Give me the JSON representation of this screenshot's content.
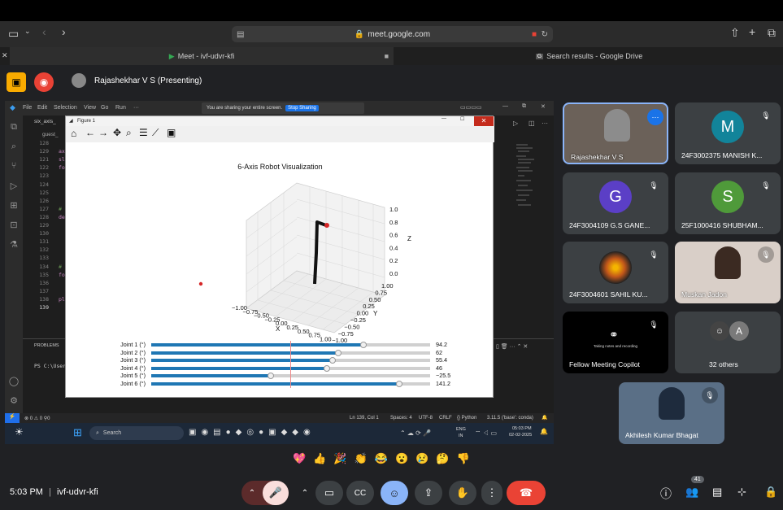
{
  "browser": {
    "url": "meet.google.com",
    "tabs": [
      {
        "label": "Meet - ivf-udvr-kfi"
      },
      {
        "label": "Search results - Google Drive"
      }
    ]
  },
  "meet": {
    "presenter_label": "Rajashekhar V S (Presenting)"
  },
  "screen_share": {
    "share_notice": "You are sharing your entire screen.",
    "stop_sharing": "Stop Sharing",
    "explorer_tab": "six_axis_",
    "breadcrumb": "guest_",
    "line_numbers": [
      "128",
      "129",
      "121",
      "122",
      "123",
      "124",
      "125",
      "126",
      "127",
      "128",
      "129",
      "130",
      "131",
      "132",
      "133",
      "134",
      "135",
      "136",
      "137",
      "138",
      "139"
    ],
    "code_snippets": [
      {
        "line": "129",
        "text": "ax_"
      },
      {
        "line": "121",
        "text": "sli"
      },
      {
        "line": "122",
        "text": "for"
      },
      {
        "line": "127",
        "text": "# U"
      },
      {
        "line": "128",
        "text": "def"
      },
      {
        "line": "134",
        "text": "# A"
      },
      {
        "line": "135",
        "text": "for"
      },
      {
        "line": "138",
        "text": "plt"
      }
    ],
    "problems_label": "PROBLEMS",
    "terminal_text": "PS C:\\User",
    "status_left": "⊗ 0 ⚠ 0   ⚲0",
    "status_right": [
      "Ln 139, Col 1",
      "Spaces: 4",
      "UTF-8",
      "CRLF",
      "{} Python",
      "3.11.5 ('base': conda)"
    ],
    "menu": [
      "File",
      "Edit",
      "Selection",
      "View",
      "Go",
      "Run",
      "···"
    ]
  },
  "figure": {
    "window_title": "Figure 1",
    "plot_title": "6-Axis Robot Visualization",
    "x_label": "X",
    "y_label": "Y",
    "z_label": "Z",
    "z_ticks": [
      "1.0",
      "0.8",
      "0.6",
      "0.4",
      "0.2",
      "0.0"
    ],
    "x_ticks": [
      "−1.00",
      "−0.75",
      "−0.50",
      "−0.25",
      "0.00",
      "0.25",
      "0.50",
      "0.75",
      "1.00"
    ],
    "y_ticks": [
      "1.00",
      "0.75",
      "0.50",
      "0.25",
      "0.00",
      "−0.25",
      "−0.50",
      "−0.75",
      "−1.00"
    ],
    "sliders": [
      {
        "label": "Joint 1 (°)",
        "value": "94.2",
        "fraction": 0.76
      },
      {
        "label": "Joint 2 (°)",
        "value": "62",
        "fraction": 0.67
      },
      {
        "label": "Joint 3 (°)",
        "value": "55.4",
        "fraction": 0.65
      },
      {
        "label": "Joint 4 (°)",
        "value": "46",
        "fraction": 0.63
      },
      {
        "label": "Joint 5 (°)",
        "value": "−25.5",
        "fraction": 0.43
      },
      {
        "label": "Joint 6 (°)",
        "value": "141.2",
        "fraction": 0.89
      }
    ]
  },
  "taskbar": {
    "search": "Search",
    "lang": "ENG",
    "lang2": "IN",
    "time": "05:03 PM",
    "date": "02-02-2025"
  },
  "participants": [
    {
      "name": "Rajashekhar V S",
      "avatar": "",
      "color": "#5f6368"
    },
    {
      "name": "24F3002375 MANISH K...",
      "avatar": "M",
      "color": "#12849a"
    },
    {
      "name": "24F3004109 G.S GANE...",
      "avatar": "G",
      "color": "#5b3fc6"
    },
    {
      "name": "25F1000416 SHUBHAM...",
      "avatar": "S",
      "color": "#4f9a3a"
    },
    {
      "name": "24F3004601 SAHIL KU...",
      "avatar": "",
      "color": "#c2571a"
    },
    {
      "name": "Muskan Jadon",
      "avatar": "",
      "color": "#b59a8a"
    },
    {
      "name": "Fellow Meeting Copilot",
      "avatar": "",
      "color": "#000000",
      "sub": "Taking notes and recording"
    },
    {
      "name": "32 others",
      "avatar": "A",
      "color": "#7a7a7a"
    },
    {
      "name": "Akhilesh Kumar Bhagat",
      "avatar": "",
      "color": "#6b7f96"
    }
  ],
  "reactions": [
    "💖",
    "👍",
    "🎉",
    "👏",
    "😂",
    "😮",
    "😢",
    "🤔",
    "👎"
  ],
  "bottom": {
    "time": "5:03 PM",
    "separator": "|",
    "meeting_code": "ivf-udvr-kfi",
    "participant_count": "41"
  }
}
